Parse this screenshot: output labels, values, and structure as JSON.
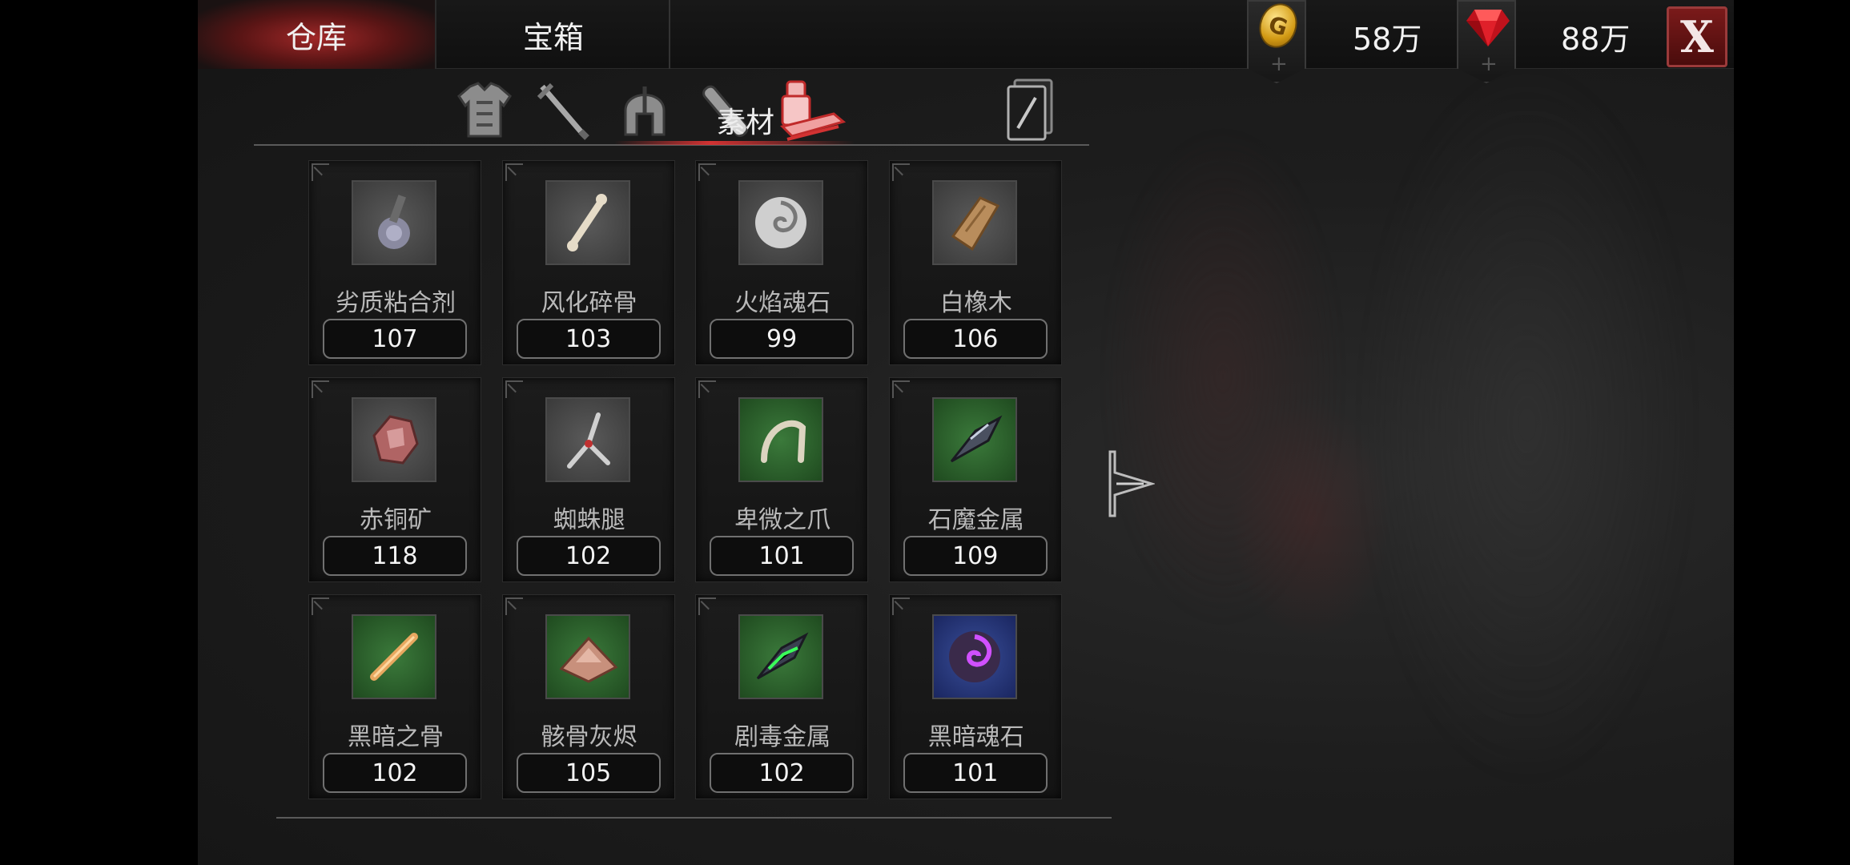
{
  "tabs": {
    "warehouse": "仓库",
    "chest": "宝箱"
  },
  "currency": {
    "gold": "58万",
    "gems": "88万"
  },
  "close_label": "X",
  "categories": {
    "icons": [
      "armor-icon",
      "sword-icon",
      "helmet-icon",
      "potion-icon",
      "material-icon",
      "card-icon"
    ],
    "active_label": "素材"
  },
  "items": [
    {
      "name": "劣质粘合剂",
      "count": "107",
      "icon": "glue-icon",
      "frame": "gray"
    },
    {
      "name": "风化碎骨",
      "count": "103",
      "icon": "bone-icon",
      "frame": "gray"
    },
    {
      "name": "火焰魂石",
      "count": "99",
      "icon": "soulstone-icon",
      "frame": "gray"
    },
    {
      "name": "白橡木",
      "count": "106",
      "icon": "wood-icon",
      "frame": "gray"
    },
    {
      "name": "赤铜矿",
      "count": "118",
      "icon": "copper-ore-icon",
      "frame": "gray"
    },
    {
      "name": "蜘蛛腿",
      "count": "102",
      "icon": "spider-leg-icon",
      "frame": "gray"
    },
    {
      "name": "卑微之爪",
      "count": "101",
      "icon": "claw-icon",
      "frame": "green"
    },
    {
      "name": "石魔金属",
      "count": "109",
      "icon": "golem-metal-icon",
      "frame": "green"
    },
    {
      "name": "黑暗之骨",
      "count": "102",
      "icon": "dark-bone-icon",
      "frame": "green"
    },
    {
      "name": "骸骨灰烬",
      "count": "105",
      "icon": "bone-ash-icon",
      "frame": "green"
    },
    {
      "name": "剧毒金属",
      "count": "102",
      "icon": "toxic-metal-icon",
      "frame": "green"
    },
    {
      "name": "黑暗魂石",
      "count": "101",
      "icon": "dark-soulstone-icon",
      "frame": "blue"
    }
  ],
  "colors": {
    "accent_red": "#d23232",
    "gold": "#d29a14",
    "gem_red": "#e0202a"
  }
}
